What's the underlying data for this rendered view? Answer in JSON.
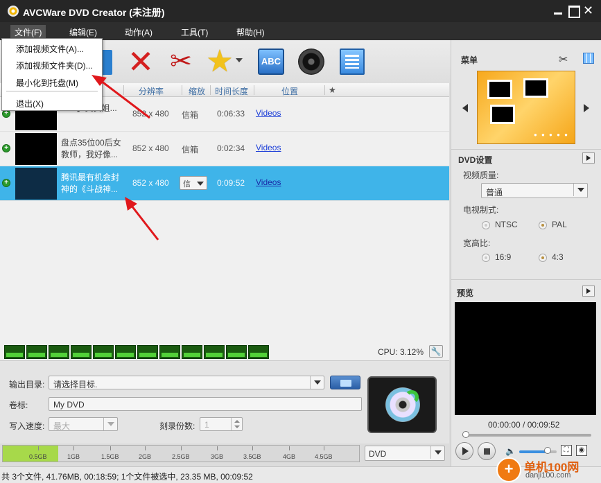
{
  "app": {
    "title": "AVCWare DVD Creator (未注册)"
  },
  "menubar": {
    "file": "文件(F)",
    "edit": "编辑(E)",
    "action": "动作(A)",
    "tools": "工具(T)",
    "help": "帮助(H)"
  },
  "file_menu": {
    "items": [
      "添加视频文件(A)...",
      "添加视频文件夹(D)...",
      "最小化到托盘(M)",
      "退出(X)"
    ]
  },
  "columns": {
    "resolution": "分辨率",
    "zoom": "缩放",
    "duration": "时间长度",
    "location": "位置",
    "star": "★"
  },
  "files": [
    {
      "name_line1": "",
      "name_line2": "EP8】其实姐...",
      "resolution": "852 x 480",
      "zoom": "信箱",
      "duration": "0:06:33",
      "location": "Videos"
    },
    {
      "name_line1": "盘点35位00后女",
      "name_line2": "教师，我好像...",
      "resolution": "852 x 480",
      "zoom": "信箱",
      "duration": "0:02:34",
      "location": "Videos"
    },
    {
      "name_line1": "腾讯最有机会封",
      "name_line2": "神的《斗战神...",
      "resolution": "852 x 480",
      "zoom": "信",
      "duration": "0:09:52",
      "location": "Videos"
    }
  ],
  "cpu": {
    "label": "CPU: 3.12%"
  },
  "output": {
    "dir_label": "输出目录:",
    "dir_value": "请选择目标.",
    "volume_label": "卷标:",
    "volume_value": "My DVD",
    "speed_label": "写入速度:",
    "speed_value": "最大",
    "copies_label": "刻录份数:",
    "copies_value": "1"
  },
  "capacity": {
    "fill_fraction": 0.155,
    "ticks": [
      "0.5GB",
      "1GB",
      "1.5GB",
      "2GB",
      "2.5GB",
      "3GB",
      "3.5GB",
      "4GB",
      "4.5GB"
    ],
    "disc_type": "DVD"
  },
  "status": {
    "text": "共 3个文件, 41.76MB, 00:18:59; 1个文件被选中, 23.35 MB, 00:09:52"
  },
  "right_panel": {
    "menu_title": "菜单",
    "dvd_settings_title": "DVD设置",
    "video_quality_label": "视频质量:",
    "video_quality_value": "普通",
    "tv_system_label": "电视制式:",
    "tv_ntsc": "NTSC",
    "tv_pal": "PAL",
    "aspect_label": "宽高比:",
    "aspect_169": "16:9",
    "aspect_43": "4:3",
    "preview_title": "预览",
    "time_display": "00:00:00 / 00:09:52"
  },
  "watermark": {
    "text": "单机100网",
    "url": "danji100.com"
  },
  "colors": {
    "selected_row": "#3fb4e9",
    "titlebar": "#262626",
    "link": "#1d3fd8"
  }
}
